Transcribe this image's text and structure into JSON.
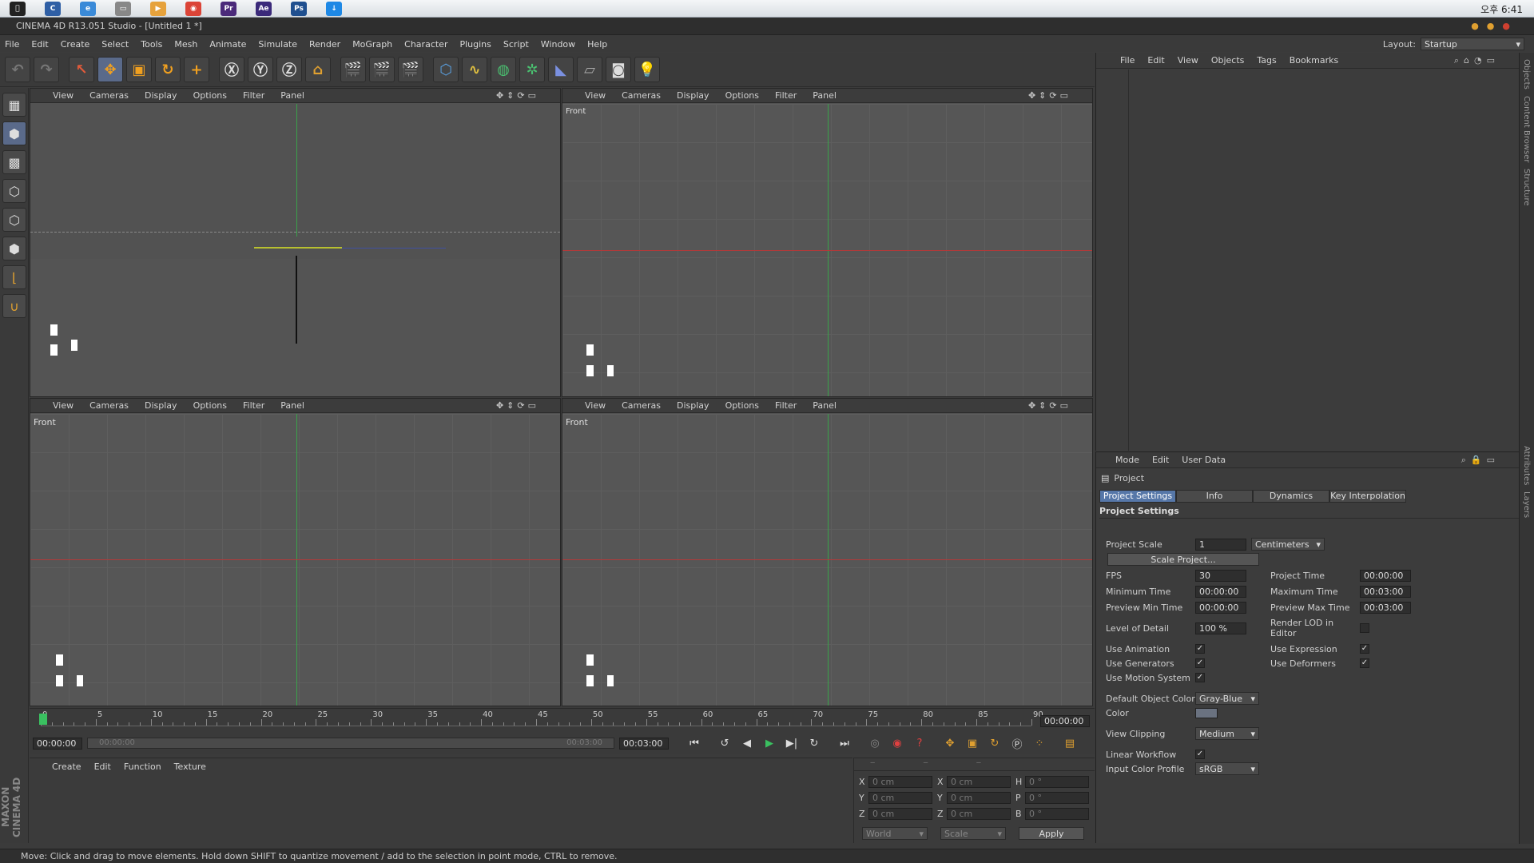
{
  "app_title": "CINEMA 4D R13.051 Studio - [Untitled 1 *]",
  "system_clock": "오후 6:41",
  "menu": [
    "File",
    "Edit",
    "Create",
    "Select",
    "Tools",
    "Mesh",
    "Animate",
    "Simulate",
    "Render",
    "MoGraph",
    "Character",
    "Plugins",
    "Script",
    "Window",
    "Help"
  ],
  "layout": {
    "label": "Layout:",
    "value": "Startup"
  },
  "viewport_menu": [
    "View",
    "Cameras",
    "Display",
    "Options",
    "Filter",
    "Panel"
  ],
  "viewports": [
    {
      "name": ""
    },
    {
      "name": "Front"
    },
    {
      "name": "Front"
    },
    {
      "name": "Front"
    }
  ],
  "object_manager": {
    "menu": [
      "File",
      "Edit",
      "View",
      "Objects",
      "Tags",
      "Bookmarks"
    ]
  },
  "side_tabs": [
    "Objects",
    "Content Browser",
    "Structure",
    "Attributes",
    "Layers"
  ],
  "attributes": {
    "menu": [
      "Mode",
      "Edit",
      "User Data"
    ],
    "object": "Project",
    "tabs": [
      "Project Settings",
      "Info",
      "Dynamics",
      "Key Interpolation"
    ],
    "section": "Project Settings",
    "project_scale": {
      "label": "Project Scale",
      "value": "1",
      "unit": "Centimeters"
    },
    "scale_button": "Scale Project...",
    "fps": {
      "label": "FPS",
      "value": "30"
    },
    "project_time": {
      "label": "Project Time",
      "value": "00:00:00"
    },
    "min_time": {
      "label": "Minimum Time",
      "value": "00:00:00"
    },
    "max_time": {
      "label": "Maximum Time",
      "value": "00:03:00"
    },
    "prev_min": {
      "label": "Preview Min Time",
      "value": "00:00:00"
    },
    "prev_max": {
      "label": "Preview Max Time",
      "value": "00:03:00"
    },
    "lod": {
      "label": "Level of Detail",
      "value": "100 %"
    },
    "render_lod": {
      "label": "Render LOD in Editor"
    },
    "use_animation": "Use Animation",
    "use_expression": "Use Expression",
    "use_generators": "Use Generators",
    "use_deformers": "Use Deformers",
    "use_motion": "Use Motion System",
    "default_color": {
      "label": "Default Object Color",
      "value": "Gray-Blue"
    },
    "color": {
      "label": "Color"
    },
    "view_clipping": {
      "label": "View Clipping",
      "value": "Medium"
    },
    "linear_workflow": "Linear Workflow",
    "input_profile": {
      "label": "Input Color Profile",
      "value": "sRGB"
    }
  },
  "timeline": {
    "ticks": [
      "0",
      "5",
      "10",
      "15",
      "20",
      "25",
      "30",
      "35",
      "40",
      "45",
      "50",
      "55",
      "60",
      "65",
      "70",
      "75",
      "80",
      "85",
      "90"
    ],
    "current": "00:00:00",
    "start": "00:00:00",
    "slider_start": "00:00:00",
    "slider_end": "00:03:00",
    "end": "00:03:00"
  },
  "material_menu": [
    "Create",
    "Edit",
    "Function",
    "Texture"
  ],
  "coords": {
    "rows": [
      {
        "a": "X",
        "av": "0 cm",
        "b": "X",
        "bv": "0 cm",
        "c": "H",
        "cv": "0 °"
      },
      {
        "a": "Y",
        "av": "0 cm",
        "b": "Y",
        "bv": "0 cm",
        "c": "P",
        "cv": "0 °"
      },
      {
        "a": "Z",
        "av": "0 cm",
        "b": "Z",
        "bv": "0 cm",
        "c": "B",
        "cv": "0 °"
      }
    ],
    "mode1": "World",
    "mode2": "Scale",
    "apply": "Apply"
  },
  "status": "Move: Click and drag to move elements. Hold down SHIFT to quantize movement / add to the selection in point mode, CTRL to remove.",
  "brand": "MAXON CINEMA 4D"
}
